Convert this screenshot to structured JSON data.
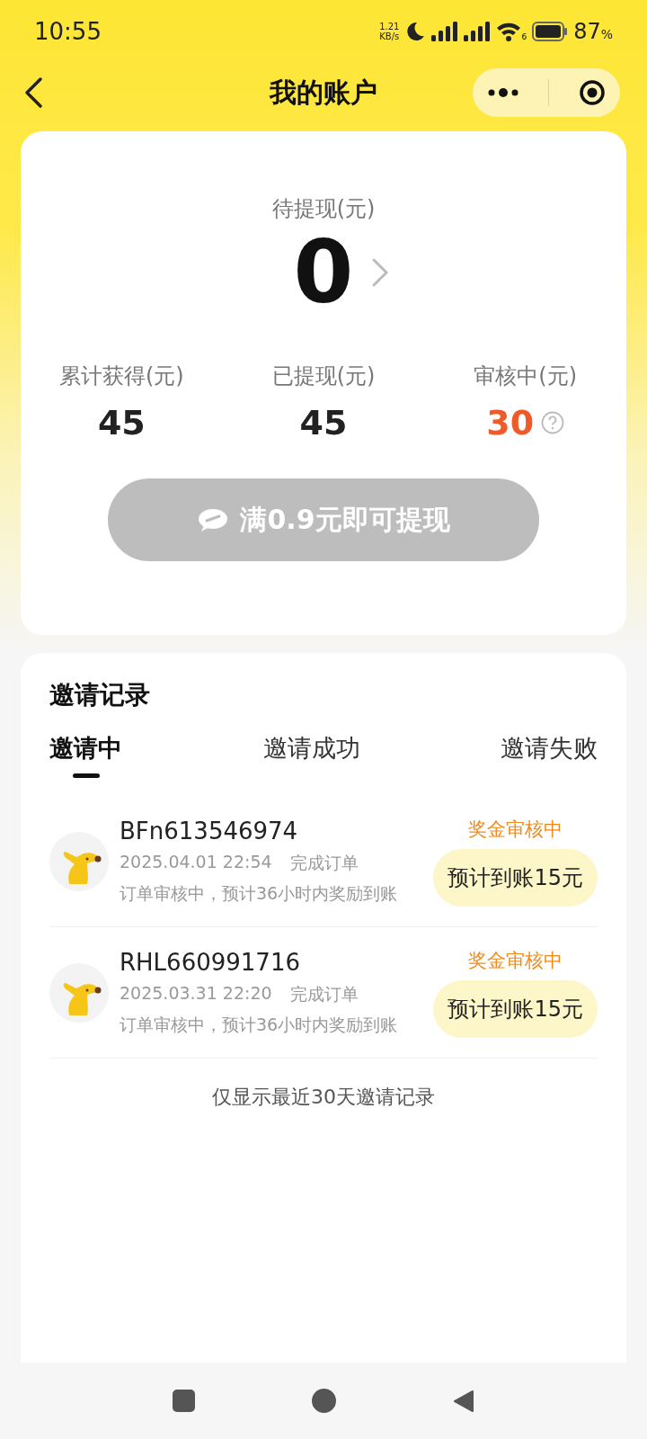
{
  "status_bar": {
    "time": "10:55",
    "net_speed": "1.21",
    "net_unit": "KB/s",
    "wifi_badge": "6",
    "battery": "87",
    "battery_unit": "%"
  },
  "nav": {
    "title": "我的账户"
  },
  "balance": {
    "label": "待提现(元)",
    "amount": "0",
    "stats": [
      {
        "label": "累计获得(元)",
        "value": "45",
        "kind": "plain"
      },
      {
        "label": "已提现(元)",
        "value": "45",
        "kind": "plain"
      },
      {
        "label": "审核中(元)",
        "value": "30",
        "kind": "pending"
      }
    ],
    "withdraw_button": {
      "label": "满0.9元即可提现",
      "disabled": true
    }
  },
  "invites": {
    "title": "邀请记录",
    "tabs": [
      {
        "label": "邀请中",
        "selected": true
      },
      {
        "label": "邀请成功",
        "selected": false
      },
      {
        "label": "邀请失败",
        "selected": false
      }
    ],
    "records": [
      {
        "id": "BFn613546974",
        "time": "2025.04.01 22:54",
        "action": "完成订单",
        "note": "订单审核中，预计36小时内奖励到账",
        "status": "奖金审核中",
        "reward": "预计到账15元"
      },
      {
        "id": "RHL660991716",
        "time": "2025.03.31 22:20",
        "action": "完成订单",
        "note": "订单审核中，预计36小时内奖励到账",
        "status": "奖金审核中",
        "reward": "预计到账15元"
      }
    ],
    "footer": "仅显示最近30天邀请记录"
  }
}
